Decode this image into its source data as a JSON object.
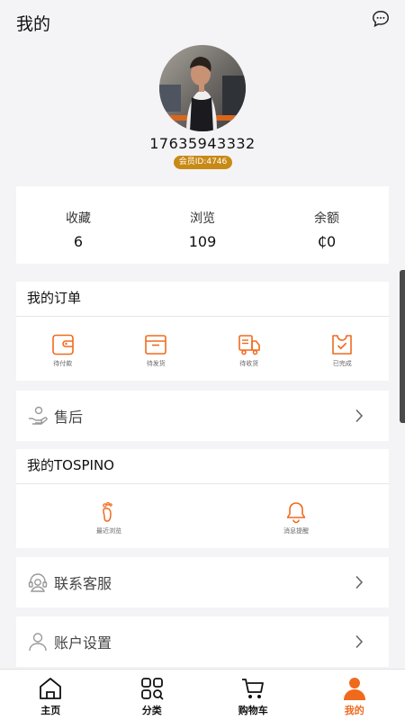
{
  "header": {
    "title": "我的",
    "message_icon": "chat-bubble-icon"
  },
  "profile": {
    "phone": "17635943332",
    "member_id": "会员ID:4746",
    "avatar": "user-photo"
  },
  "stats": [
    {
      "label": "收藏",
      "value": "6"
    },
    {
      "label": "浏览",
      "value": "109"
    },
    {
      "label": "余额",
      "value": "₵0"
    }
  ],
  "orders": {
    "title": "我的订单",
    "items": [
      {
        "label": "待付款",
        "icon": "wallet-icon"
      },
      {
        "label": "待发货",
        "icon": "box-icon"
      },
      {
        "label": "待收货",
        "icon": "truck-icon"
      },
      {
        "label": "已完成",
        "icon": "check-bag-icon"
      }
    ]
  },
  "after_sale": {
    "label": "售后",
    "icon": "hand-coin-icon"
  },
  "brand": {
    "title": "我的TOSPINO",
    "items": [
      {
        "label": "最近浏览",
        "icon": "footprint-icon"
      },
      {
        "label": "消息提醒",
        "icon": "bell-icon"
      }
    ]
  },
  "service": {
    "label": "联系客服",
    "icon": "headset-icon"
  },
  "settings": {
    "label": "账户设置",
    "icon": "user-outline-icon"
  },
  "tabbar": [
    {
      "label": "主页",
      "icon": "home-icon",
      "active": false
    },
    {
      "label": "分类",
      "icon": "category-icon",
      "active": false
    },
    {
      "label": "购物车",
      "icon": "cart-icon",
      "active": false
    },
    {
      "label": "我的",
      "icon": "profile-icon",
      "active": true
    }
  ],
  "colors": {
    "accent": "#f06a1e",
    "badge": "#c88a16",
    "background": "#f4f4f6"
  }
}
